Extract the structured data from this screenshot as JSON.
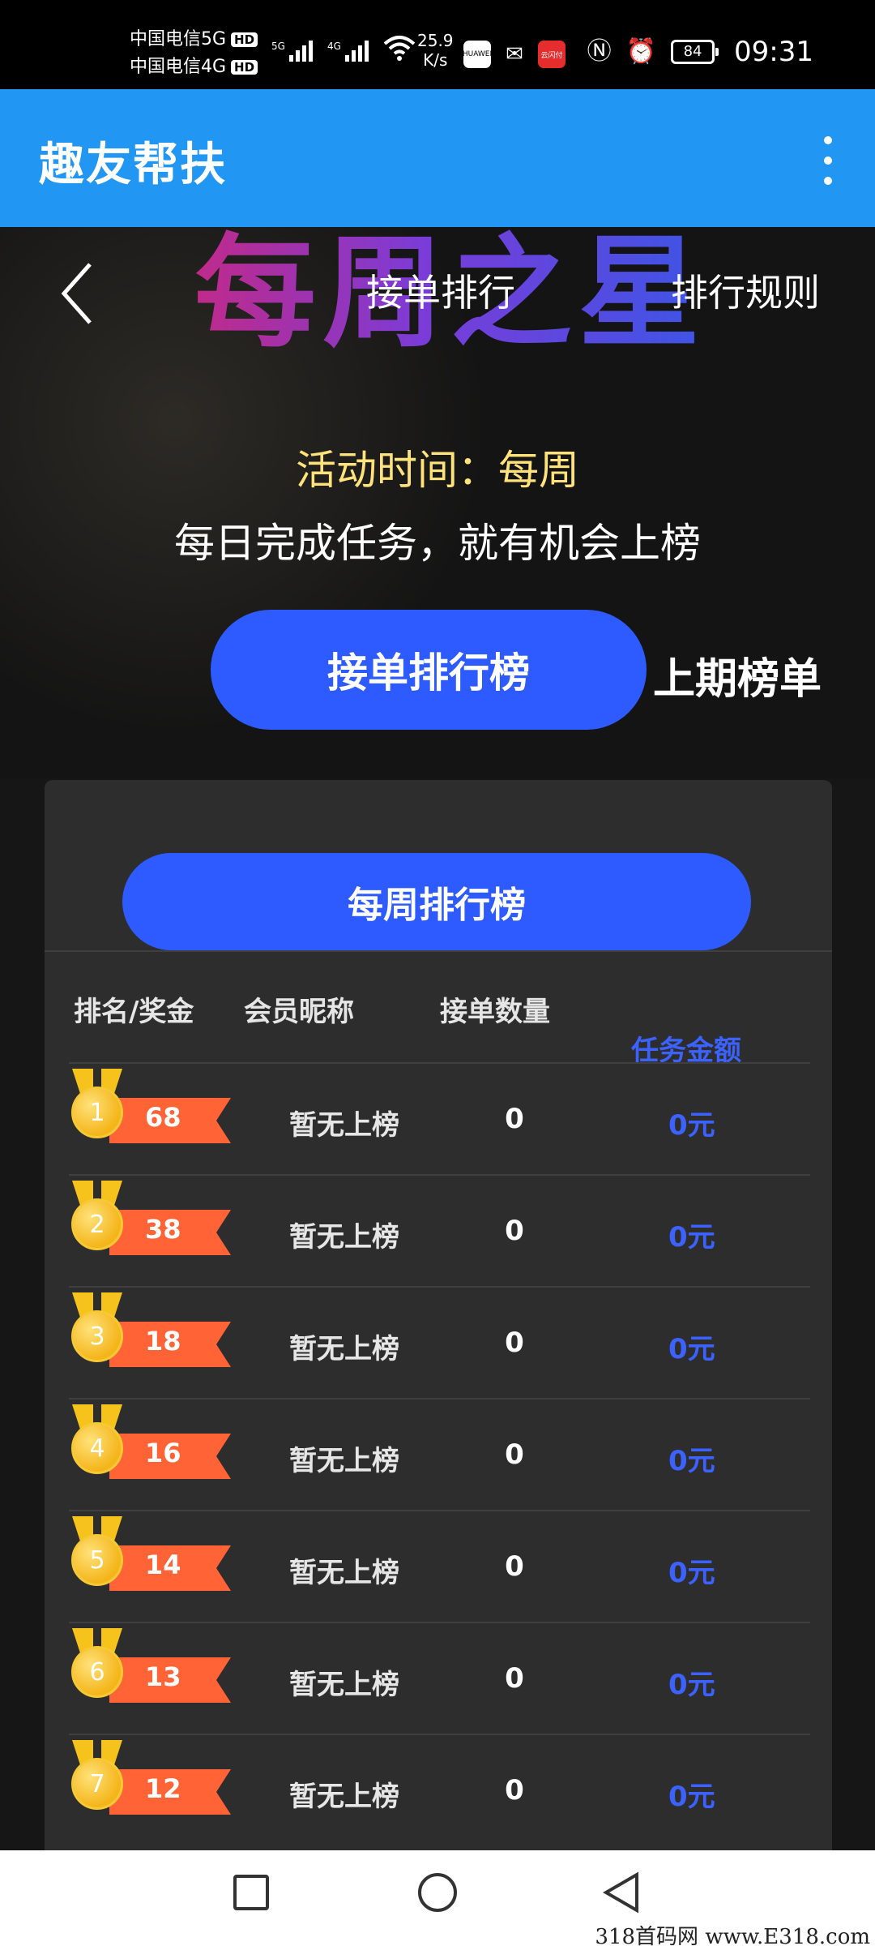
{
  "status_bar": {
    "carrier1": "中国电信5G",
    "carrier2": "中国电信4G",
    "hd_badge": "HD",
    "sig1_tag": "5G",
    "sig2_tag": "4G",
    "speed_value": "25.9",
    "speed_unit": "K/s",
    "app1": "HUAWEI",
    "app2": "云闪付",
    "battery": "84",
    "time": "09:31"
  },
  "app_bar": {
    "title": "趣友帮扶"
  },
  "hero": {
    "banner_title": "每周之星",
    "nav_title": "接单排行",
    "rules_link": "排行规则",
    "activity_time": "活动时间：每周",
    "subtitle": "每日完成任务，就有机会上榜",
    "tab_active": "接单排行榜",
    "tab_inactive": "上期榜单"
  },
  "board": {
    "tab_label": "每周排行榜",
    "columns": [
      "排名/奖金",
      "会员昵称",
      "接单数量",
      "任务金额"
    ],
    "rows": [
      {
        "rank": "1",
        "prize": "68",
        "nickname": "暂无上榜",
        "count": "0",
        "amount": "0元"
      },
      {
        "rank": "2",
        "prize": "38",
        "nickname": "暂无上榜",
        "count": "0",
        "amount": "0元"
      },
      {
        "rank": "3",
        "prize": "18",
        "nickname": "暂无上榜",
        "count": "0",
        "amount": "0元"
      },
      {
        "rank": "4",
        "prize": "16",
        "nickname": "暂无上榜",
        "count": "0",
        "amount": "0元"
      },
      {
        "rank": "5",
        "prize": "14",
        "nickname": "暂无上榜",
        "count": "0",
        "amount": "0元"
      },
      {
        "rank": "6",
        "prize": "13",
        "nickname": "暂无上榜",
        "count": "0",
        "amount": "0元"
      },
      {
        "rank": "7",
        "prize": "12",
        "nickname": "暂无上榜",
        "count": "0",
        "amount": "0元"
      }
    ]
  },
  "watermark": "318首码网  www.E318.com",
  "colors": {
    "app_bar": "#2196f3",
    "accent_blue": "#2e5bff",
    "amount_blue": "#3b62ff",
    "activity_yellow": "#ffe37a",
    "prize_ribbon": "#ff6336",
    "medal_gold": "#f4b51a"
  },
  "icons": {
    "back": "chevron-left-icon",
    "more": "more-vertical-icon",
    "nav_recent": "square-icon",
    "nav_home": "circle-icon",
    "nav_back": "triangle-back-icon"
  }
}
